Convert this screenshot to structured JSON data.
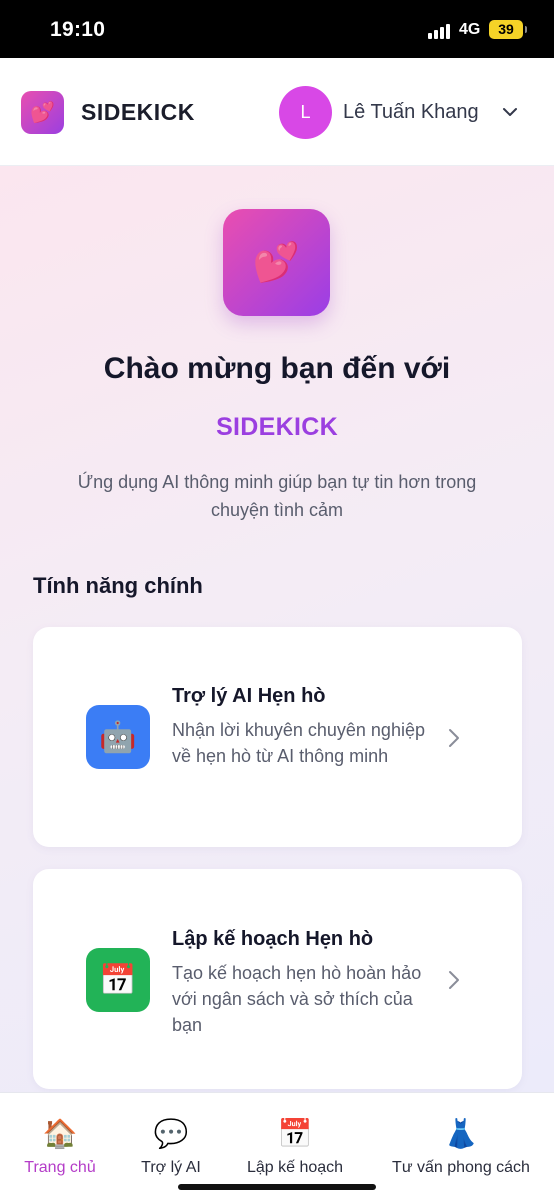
{
  "status_bar": {
    "time": "19:10",
    "network": "4G",
    "battery": "39"
  },
  "header": {
    "logo_icon": "💕",
    "brand": "SIDEKICK",
    "avatar_initial": "L",
    "user_name": "Lê Tuấn Khang"
  },
  "hero": {
    "icon": "💕",
    "welcome": "Chào mừng bạn đến với",
    "brand": "SIDEKICK",
    "tagline": "Ứng dụng AI thông minh giúp bạn tự tin hơn trong chuyện tình cảm"
  },
  "features": {
    "section_title": "Tính năng chính",
    "items": [
      {
        "icon": "🤖",
        "icon_name": "robot-icon",
        "color": "#3b7df5",
        "title": "Trợ lý AI Hẹn hò",
        "description": "Nhận lời khuyên chuyên nghiệp về hẹn hò từ AI thông minh"
      },
      {
        "icon": "📅",
        "icon_name": "calendar-icon",
        "color": "#22b357",
        "title": "Lập kế hoạch Hẹn hò",
        "description": "Tạo kế hoạch hẹn hò hoàn hảo với ngân sách và sở thích của bạn"
      }
    ]
  },
  "bottom_nav": {
    "items": [
      {
        "icon": "🏠",
        "icon_name": "home-icon",
        "label": "Trang chủ",
        "active": true
      },
      {
        "icon": "💬",
        "icon_name": "chat-icon",
        "label": "Trợ lý AI",
        "active": false
      },
      {
        "icon": "📅",
        "icon_name": "calendar-icon",
        "label": "Lập kế hoạch",
        "active": false
      },
      {
        "icon": "👗",
        "icon_name": "dress-icon",
        "label": "Tư vấn phong cách",
        "active": false
      }
    ]
  },
  "colors": {
    "accent": "#9b3fe0",
    "active_nav": "#b43cc8",
    "avatar": "#d848e6"
  }
}
